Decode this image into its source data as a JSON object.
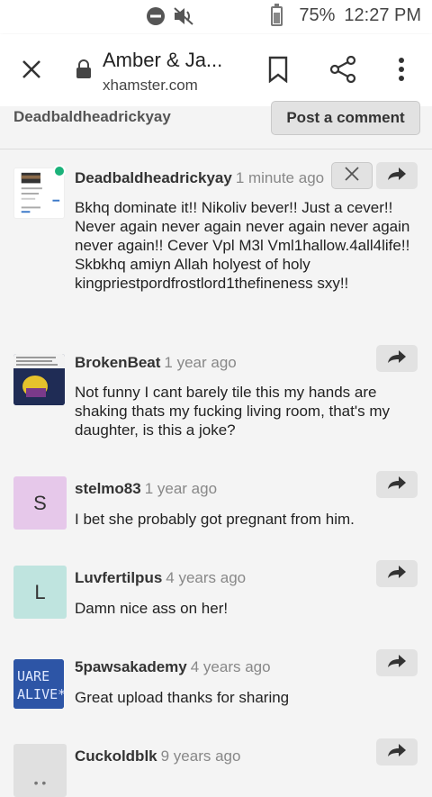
{
  "status_bar": {
    "battery": "75%",
    "time": "12:27 PM"
  },
  "browser": {
    "title": "Amber & Ja...",
    "url": "xhamster.com"
  },
  "header": {
    "username": "Deadbaldheadrickyay",
    "post_button": "Post a comment"
  },
  "comments": [
    {
      "name": "Deadbaldheadrickyay",
      "time": "1 minute ago",
      "text": "Bkhq dominate it!! Nikoliv bever!! Just a cever!! Never again never again never again never again never again!! Cever Vpl M3l Vml1hallow.4all4life!! Skbkhq amiyn Allah holyest of holy kingpriestpordfrostlord1thefineness sxy!!",
      "avatar_type": "image",
      "online": true
    },
    {
      "name": "BrokenBeat",
      "time": "1 year ago",
      "text": "Not funny I cant barely tile this my hands are shaking thats my fucking living room, that's my daughter, is this a joke?",
      "avatar_type": "image"
    },
    {
      "name": "stelmo83",
      "time": "1 year ago",
      "text": "I bet she probably got pregnant from him.",
      "avatar_letter": "S",
      "avatar_color": "#e6c8ea"
    },
    {
      "name": "Luvfertilpus",
      "time": "4 years ago",
      "text": "Damn nice ass on her!",
      "avatar_letter": "L",
      "avatar_color": "#bfe4df"
    },
    {
      "name": "5pawsakademy",
      "time": "4 years ago",
      "text": "Great upload thanks for sharing",
      "avatar_type": "image"
    },
    {
      "name": "Cuckoldblk",
      "time": "9 years ago",
      "text": "",
      "avatar_color": "#e0e0e0"
    }
  ]
}
